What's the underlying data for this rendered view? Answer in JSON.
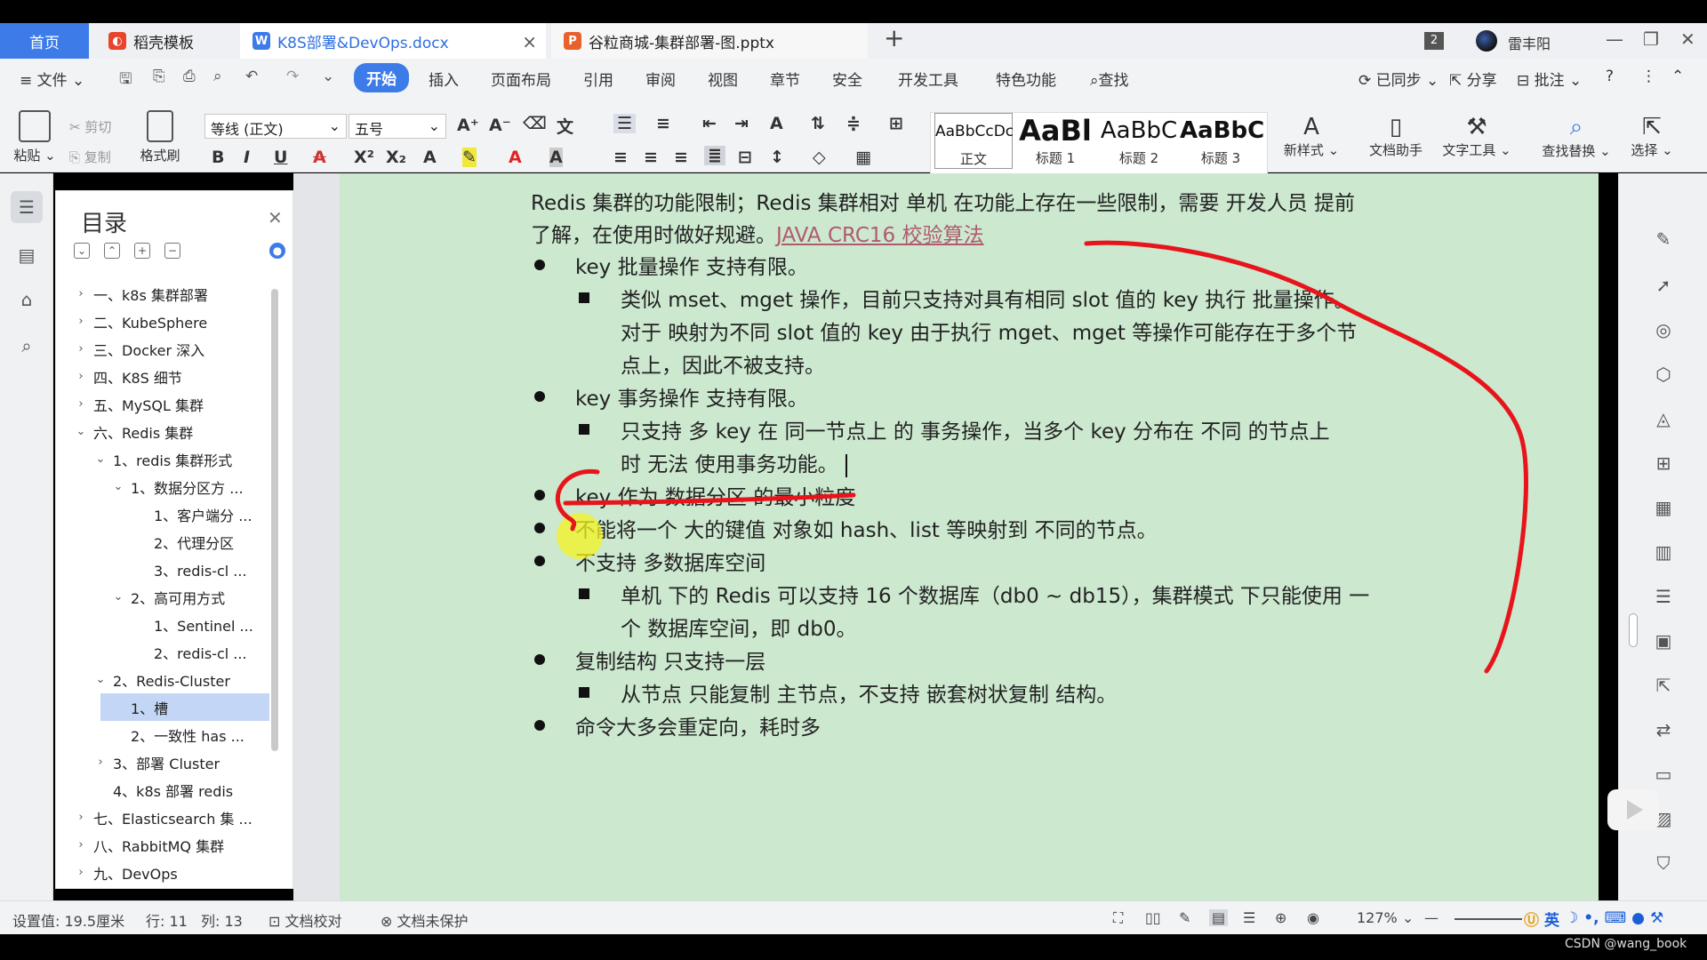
{
  "tabs": {
    "home": "首页",
    "template": "稻壳模板",
    "doc": "K8S部署&DevOps.docx",
    "ppt": "谷粒商城-集群部署-图.pptx",
    "add": "+",
    "window_count": "2",
    "user": "雷丰阳"
  },
  "menu": {
    "file": "文件",
    "items": [
      "开始",
      "插入",
      "页面布局",
      "引用",
      "审阅",
      "视图",
      "章节",
      "安全",
      "开发工具",
      "特色功能"
    ],
    "search": "查找",
    "sync": "已同步",
    "share": "分享",
    "comment": "批注"
  },
  "ribbon": {
    "paste": "粘贴",
    "cut": "剪切",
    "copy": "复制",
    "format_painter": "格式刷",
    "font_name": "等线 (正文)",
    "font_size": "五号",
    "styles": [
      {
        "sample": "AaBbCcDc",
        "name": "正文"
      },
      {
        "sample": "AaBl",
        "name": "标题 1"
      },
      {
        "sample": "AaBbC",
        "name": "标题 2"
      },
      {
        "sample": "AaBbC",
        "name": "标题 3"
      }
    ],
    "new_style": "新样式",
    "doc_helper": "文档助手",
    "text_tools": "文字工具",
    "find_replace": "查找替换",
    "select": "选择"
  },
  "toc": {
    "title": "目录",
    "items": [
      {
        "label": "一、k8s 集群部署",
        "level": 0,
        "arrow": "›",
        "selected": false
      },
      {
        "label": "二、KubeSphere",
        "level": 0,
        "arrow": "›",
        "selected": false
      },
      {
        "label": "三、Docker 深入",
        "level": 0,
        "arrow": "›",
        "selected": false
      },
      {
        "label": "四、K8S 细节",
        "level": 0,
        "arrow": "›",
        "selected": false
      },
      {
        "label": "五、MySQL 集群",
        "level": 0,
        "arrow": "›",
        "selected": false
      },
      {
        "label": "六、Redis 集群",
        "level": 0,
        "arrow": "⌄",
        "selected": false
      },
      {
        "label": "1、redis 集群形式",
        "level": 1,
        "arrow": "⌄",
        "selected": false
      },
      {
        "label": "1、数据分区方 ...",
        "level": 2,
        "arrow": "⌄",
        "selected": false
      },
      {
        "label": "1、客户端分 ...",
        "level": 3,
        "arrow": "",
        "selected": false
      },
      {
        "label": "2、代理分区",
        "level": 3,
        "arrow": "",
        "selected": false
      },
      {
        "label": "3、redis-cl ...",
        "level": 3,
        "arrow": "",
        "selected": false
      },
      {
        "label": "2、高可用方式",
        "level": 2,
        "arrow": "⌄",
        "selected": false
      },
      {
        "label": "1、Sentinel ...",
        "level": 3,
        "arrow": "",
        "selected": false
      },
      {
        "label": "2、redis-cl ...",
        "level": 3,
        "arrow": "",
        "selected": false
      },
      {
        "label": "2、Redis-Cluster",
        "level": 1,
        "arrow": "⌄",
        "selected": false
      },
      {
        "label": "1、槽",
        "level": 2,
        "arrow": "",
        "selected": true
      },
      {
        "label": "2、一致性 has ...",
        "level": 2,
        "arrow": "",
        "selected": false
      },
      {
        "label": "3、部署 Cluster",
        "level": 1,
        "arrow": "›",
        "selected": false
      },
      {
        "label": "4、k8s 部署 redis",
        "level": 1,
        "arrow": "",
        "selected": false
      },
      {
        "label": "七、Elasticsearch 集 ...",
        "level": 0,
        "arrow": "›",
        "selected": false
      },
      {
        "label": "八、RabbitMQ 集群",
        "level": 0,
        "arrow": "›",
        "selected": false
      },
      {
        "label": "九、DevOps",
        "level": 0,
        "arrow": "›",
        "selected": false
      }
    ]
  },
  "document": {
    "intro_line1": "Redis 集群的功能限制；Redis  集群相对 单机 在功能上存在一些限制，需要 开发人员 提前",
    "intro_line2": "了解，在使用时做好规避。",
    "intro_link": "JAVA CRC16 校验算法",
    "b1": "key 批量操作 支持有限。",
    "b1_sub1": "类似  mset、mget  操作，目前只支持对具有相同  slot  值的  key  执行 批量操作。",
    "b1_sub2": "对于 映射为不同 slot  值的  key  由于执行  mget、mget  等操作可能存在于多个节",
    "b1_sub3": "点上，因此不被支持。",
    "b2": "key 事务操作 支持有限。",
    "b2_sub1": "只支持 多 key  在 同一节点上 的 事务操作，当多个  key  分布在 不同 的节点上",
    "b2_sub2": "时 无法 使用事务功能。",
    "b3": "key  作为 数据分区 的最小粒度",
    "b4": "不能将一个 大的键值 对象如  hash、list  等映射到 不同的节点。",
    "b5": "不支持 多数据库空间",
    "b5_sub1": "单机 下的  Redis  可以支持  16  个数据库（db0 ~ db15），集群模式 下只能使用 一",
    "b5_sub2": "个 数据库空间，即  db0。",
    "b6": "复制结构 只支持一层",
    "b6_sub1": "从节点 只能复制 主节点，不支持 嵌套树状复制 结构。",
    "b7": "命令大多会重定向，耗时多"
  },
  "status": {
    "setting": "设置值: 19.5厘米",
    "row": "行: 11",
    "col": "列: 13",
    "proof": "文档校对",
    "protect": "文档未保护",
    "zoom": "127%"
  },
  "ime": {
    "lang": "英"
  },
  "watermark": "CSDN @wang_book",
  "colors": {
    "accent": "#3c7be8",
    "page_bg": "#cce8cf",
    "annotation": "#e8141b",
    "highlight": "#f4f420"
  }
}
